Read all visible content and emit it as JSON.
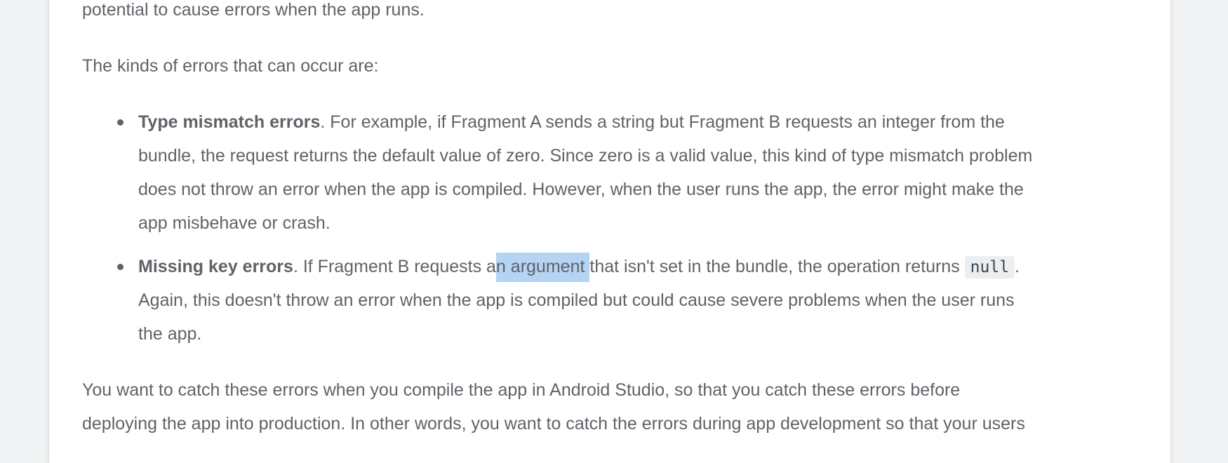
{
  "colors": {
    "page_background": "#f1f3f4",
    "card_background": "#ffffff",
    "body_text": "#5f6368",
    "selection_highlight": "#b5d3f3",
    "code_background": "#eceff1"
  },
  "article": {
    "intro_tail": "potential to cause errors when the app runs.",
    "kinds_intro": "The kinds of errors that can occur are:",
    "type_mismatch": {
      "title": "Type mismatch errors",
      "line1_rest": ". For example, if Fragment A sends a string but Fragment B requests an integer from the",
      "line2": "bundle, the request returns the default value of zero. Since zero is a valid value, this kind of type mismatch problem",
      "line3": "does not throw an error when the app is compiled. However, when the user runs the app, the error might make the",
      "line4": "app misbehave or crash."
    },
    "missing_key": {
      "title": "Missing key errors",
      "line1_before": ". If Fragment B requests a",
      "line1_selected": "n argument ",
      "line1_after": "that isn't set in the bundle, the operation returns ",
      "code": "null",
      "line1_end": ".",
      "line2": "Again, this doesn't throw an error when the app is compiled but could cause severe problems when the user runs",
      "line3": "the app."
    },
    "closing": {
      "line1": "You want to catch these errors when you compile the app in Android Studio, so that you catch these errors before",
      "line2": "deploying the app into production. In other words, you want to catch the errors during app development so that your users"
    }
  }
}
